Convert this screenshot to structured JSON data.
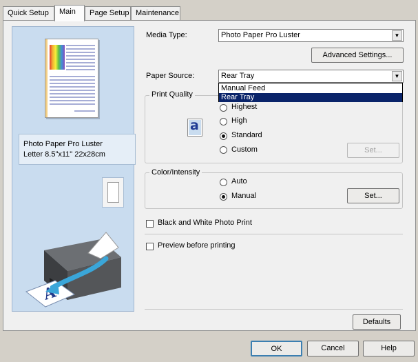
{
  "tabs": [
    {
      "label": "Quick Setup"
    },
    {
      "label": "Main"
    },
    {
      "label": "Page Setup"
    },
    {
      "label": "Maintenance"
    }
  ],
  "preview": {
    "paper_info_line1": "Photo Paper Pro Luster",
    "paper_info_line2": "Letter 8.5\"x11\" 22x28cm"
  },
  "media_type": {
    "label": "Media Type:",
    "value": "Photo Paper Pro Luster"
  },
  "advanced_settings_label": "Advanced Settings...",
  "paper_source": {
    "label": "Paper Source:",
    "value": "Rear Tray",
    "options": [
      "Manual Feed",
      "Rear Tray"
    ],
    "selected_option": "Rear Tray"
  },
  "print_quality": {
    "title": "Print Quality",
    "options": [
      "Highest",
      "High",
      "Standard",
      "Custom"
    ],
    "selected": "Standard",
    "set_label": "Set..."
  },
  "color_intensity": {
    "title": "Color/Intensity",
    "options": [
      "Auto",
      "Manual"
    ],
    "selected": "Manual",
    "set_label": "Set..."
  },
  "bw_photo_label": "Black and White Photo Print",
  "preview_before_label": "Preview before printing",
  "defaults_label": "Defaults",
  "footer": {
    "ok": "OK",
    "cancel": "Cancel",
    "help": "Help"
  },
  "colors": {
    "preview_bg": "#c9dcef",
    "selection": "#0a246a"
  }
}
